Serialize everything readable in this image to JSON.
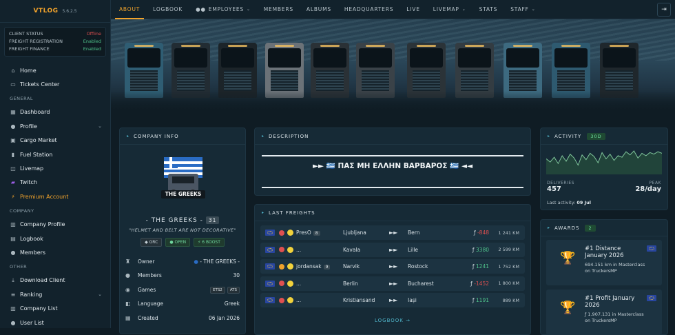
{
  "brand": {
    "name": "VTLOG",
    "version": "5.6.2.5"
  },
  "status": [
    {
      "label": "Client Status",
      "value": "Offline",
      "state": "off"
    },
    {
      "label": "Freight Registration",
      "value": "Enabled",
      "state": "en"
    },
    {
      "label": "Freight Finance",
      "value": "Enabled",
      "state": "en"
    }
  ],
  "menu": {
    "top": [
      {
        "label": "Home",
        "icon": "home-icon"
      },
      {
        "label": "Tickets Center",
        "icon": "ticket-icon"
      }
    ],
    "general_title": "GENERAL",
    "general": [
      {
        "label": "Dashboard",
        "icon": "dashboard-icon"
      },
      {
        "label": "Profile",
        "icon": "user-icon"
      },
      {
        "label": "Cargo Market",
        "icon": "cart-icon"
      },
      {
        "label": "Fuel Station",
        "icon": "fuel-icon"
      },
      {
        "label": "Livemap",
        "icon": "map-icon"
      },
      {
        "label": "Twitch",
        "icon": "twitch-icon"
      },
      {
        "label": "Premium Account",
        "icon": "bolt-icon"
      }
    ],
    "company_title": "COMPANY",
    "company": [
      {
        "label": "Company Profile",
        "icon": "building-icon"
      },
      {
        "label": "Logbook",
        "icon": "book-icon"
      },
      {
        "label": "Members",
        "icon": "users-icon"
      }
    ],
    "other_title": "OTHER",
    "other": [
      {
        "label": "Download Client",
        "icon": "download-icon"
      },
      {
        "label": "Ranking",
        "icon": "list-icon"
      },
      {
        "label": "Company List",
        "icon": "building-icon"
      },
      {
        "label": "User List",
        "icon": "users-icon"
      }
    ]
  },
  "nav": [
    "ABOUT",
    "LOGBOOK",
    "EMPLOYEES",
    "MEMBERS",
    "ALBUMS",
    "HEADQUARTERS",
    "LIVE",
    "LIVEMAP",
    "STATS",
    "STAFF"
  ],
  "company_info": {
    "title": "COMPANY INFO",
    "logo_text": "THE GREEKS",
    "name": "- THE GREEKS -",
    "members_count": "31",
    "slogan": "\"HELMET AND BELT ARE NOT DECORATIVE\"",
    "tags": [
      "GRC",
      "OPEN",
      "6 BOOST"
    ],
    "rows": {
      "owner_label": "Owner",
      "owner": "- THE GREEKS -",
      "members_label": "Members",
      "members": "30",
      "games_label": "Games",
      "games": [
        "ETS2",
        "ATS"
      ],
      "language_label": "Language",
      "language": "Greek",
      "created_label": "Created",
      "created": "06 Jan 2026"
    }
  },
  "description": {
    "title": "DESCRIPTION",
    "text": "►► 🇬🇷 ΠΑΣ ΜΗ ΕΛΛΗΝ ΒΑΡΒΑΡΟΣ 🇬🇷 ◄◄"
  },
  "freights": {
    "title": "LAST FREIGHTS",
    "rows": [
      {
        "driver": "PresO",
        "level": "8",
        "from": "Ljubljana",
        "to": "Bern",
        "income": "-848",
        "km": "1 241 KM",
        "status": "red",
        "sign": "neg"
      },
      {
        "driver": "...",
        "level": "",
        "from": "Kavala",
        "to": "Lille",
        "income": "3380",
        "km": "2 599 KM",
        "status": "red",
        "sign": "pos"
      },
      {
        "driver": "jordansak",
        "level": "9",
        "from": "Narvik",
        "to": "Rostock",
        "income": "1241",
        "km": "1 752 KM",
        "status": "orange",
        "sign": "pos"
      },
      {
        "driver": "...",
        "level": "",
        "from": "Berlin",
        "to": "Bucharest",
        "income": "-1452",
        "km": "1 800 KM",
        "status": "red",
        "sign": "neg"
      },
      {
        "driver": "...",
        "level": "",
        "from": "Kristiansand",
        "to": "Iași",
        "income": "1191",
        "km": "889 KM",
        "status": "red",
        "sign": "pos"
      }
    ],
    "logbook_link": "LOGBOOK →"
  },
  "activity": {
    "title": "ACTIVITY",
    "range": "30D",
    "deliveries_label": "DELIVERIES",
    "deliveries": "457",
    "peak_label": "PEAK",
    "peak": "28/day",
    "last_label": "Last activity:",
    "last": "09 Jul",
    "series": [
      18,
      14,
      20,
      12,
      22,
      15,
      24,
      19,
      10,
      23,
      17,
      25,
      21,
      13,
      26,
      18,
      24,
      16,
      22,
      20,
      27,
      23,
      28,
      19,
      25,
      22,
      26,
      24,
      27,
      25
    ]
  },
  "awards": {
    "title": "AWARDS",
    "count": "2",
    "items": [
      {
        "title": "#1 Distance January 2026",
        "sub": "694.151 km in Masterclass on TruckersMP"
      },
      {
        "title": "#1 Profit January 2026",
        "sub": "ƒ 1.907.131 in Masterclass on TruckersMP"
      }
    ]
  },
  "colors": {
    "accent": "#f2a32b",
    "positive": "#4fc38b",
    "negative": "#e05050",
    "info": "#4fb3c8"
  }
}
